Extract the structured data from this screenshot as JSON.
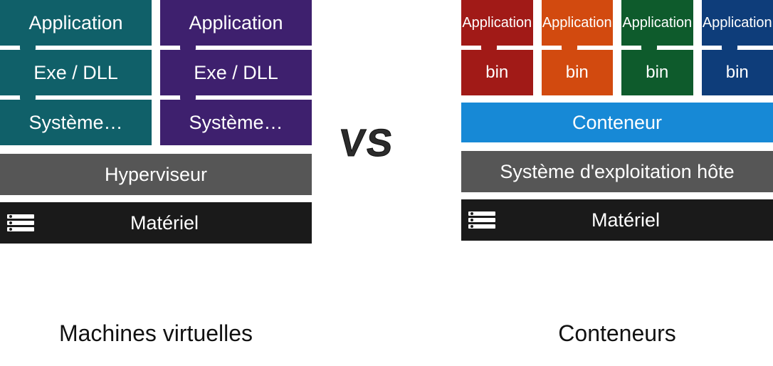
{
  "vs_label": "VS",
  "left": {
    "title": "Machines virtuelles",
    "vm1": {
      "app": "Application",
      "exe": "Exe / DLL",
      "os": "Système…"
    },
    "vm2": {
      "app": "Application",
      "exe": "Exe / DLL",
      "os": "Système…"
    },
    "hypervisor": "Hyperviseur",
    "hardware": "Matériel"
  },
  "right": {
    "title": "Conteneurs",
    "c1": {
      "app": "Application",
      "bin": "bin"
    },
    "c2": {
      "app": "Application",
      "bin": "bin"
    },
    "c3": {
      "app": "Application",
      "bin": "bin"
    },
    "c4": {
      "app": "Application",
      "bin": "bin"
    },
    "container_engine": "Conteneur",
    "host_os": "Système d'exploitation hôte",
    "hardware": "Matériel"
  }
}
